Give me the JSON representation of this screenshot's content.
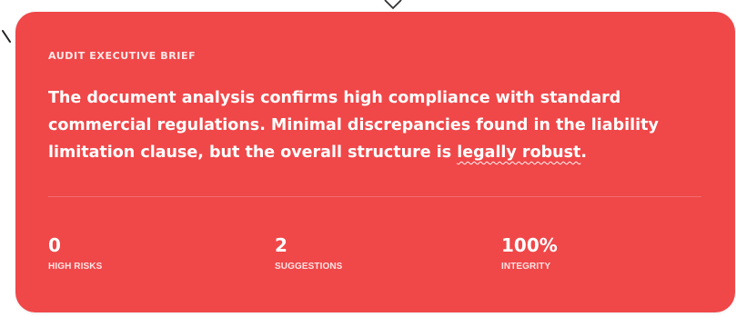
{
  "brief": {
    "eyebrow": "AUDIT EXECUTIVE BRIEF",
    "summary_before": "The document analysis confirms high compliance with standard commercial regulations. Minimal discrepancies found in the liability limitation clause, but the overall structure is ",
    "summary_highlight": "legally robust",
    "summary_after": "."
  },
  "stats": [
    {
      "value": "0",
      "label": "HIGH RISKS"
    },
    {
      "value": "2",
      "label": "SUGGESTIONS"
    },
    {
      "value": "100%",
      "label": "INTEGRITY"
    }
  ],
  "colors": {
    "card": "#f04749",
    "text": "#ffffff",
    "muted": "#ffe9e9"
  }
}
